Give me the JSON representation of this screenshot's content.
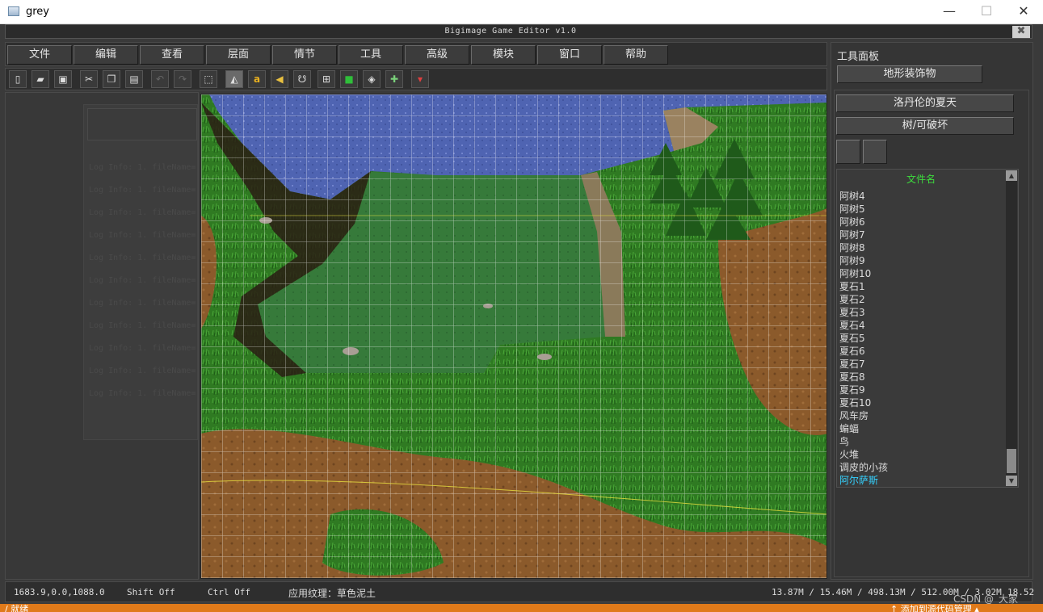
{
  "window": {
    "title": "grey",
    "minimize": "—",
    "maximize": "☐",
    "close": "✕"
  },
  "editor": {
    "title": "Bigimage Game Editor v1.0",
    "close": "✖"
  },
  "menu": [
    "文件",
    "编辑",
    "查看",
    "层面",
    "情节",
    "工具",
    "高级",
    "模块",
    "窗口",
    "帮助"
  ],
  "toolbar": [
    {
      "icon": "new-file-icon",
      "glyph": "▯"
    },
    {
      "icon": "open-folder-icon",
      "glyph": "▰"
    },
    {
      "icon": "save-icon",
      "glyph": "▣"
    },
    {
      "icon": "cut-icon",
      "glyph": "✂"
    },
    {
      "icon": "copy-icon",
      "glyph": "❐"
    },
    {
      "icon": "paste-icon",
      "glyph": "▤"
    },
    {
      "icon": "undo-icon",
      "glyph": "↶"
    },
    {
      "icon": "redo-icon",
      "glyph": "↷"
    },
    {
      "icon": "select-icon",
      "glyph": "⬚"
    },
    {
      "icon": "terrain-icon",
      "glyph": "◭"
    },
    {
      "icon": "text-icon",
      "glyph": "a"
    },
    {
      "icon": "sound-icon",
      "glyph": "◀"
    },
    {
      "icon": "unit-icon",
      "glyph": "☋"
    },
    {
      "icon": "doodad-icon",
      "glyph": "⊞"
    },
    {
      "icon": "minimap-icon",
      "glyph": "■"
    },
    {
      "icon": "object-icon",
      "glyph": "◈"
    },
    {
      "icon": "import-icon",
      "glyph": "✚"
    },
    {
      "icon": "test-map-icon",
      "glyph": "▾"
    }
  ],
  "log": {
    "line": "Log Info: 1. fileName="
  },
  "panel": {
    "heading": "工具面板",
    "category": "地形装饰物",
    "tileset": "洛丹伦的夏天",
    "subcategory": "树/可破坏",
    "list_header": "文件名",
    "items": [
      "阿树4",
      "阿树5",
      "阿树6",
      "阿树7",
      "阿树8",
      "阿树9",
      "阿树10",
      "夏石1",
      "夏石2",
      "夏石3",
      "夏石4",
      "夏石5",
      "夏石6",
      "夏石7",
      "夏石8",
      "夏石9",
      "夏石10",
      "风车房",
      "蝙蝠",
      "鸟",
      "火堆",
      "调皮的小孩",
      "阿尔萨斯"
    ],
    "selected_index": 22
  },
  "status": {
    "coords": "1683.9,0.0,1088.0",
    "shift": "Shift Off",
    "ctrl": "Ctrl Off",
    "texture": "应用纹理：草色泥土",
    "memory": "13.87M / 15.46M / 498.13M / 512.00M / 3.02M",
    "fps": "18.52"
  },
  "watermark": "CSDN @_大家_",
  "ide": {
    "left": "/ 就绪",
    "right": "↑ 添加到源代码管理 ▴"
  }
}
